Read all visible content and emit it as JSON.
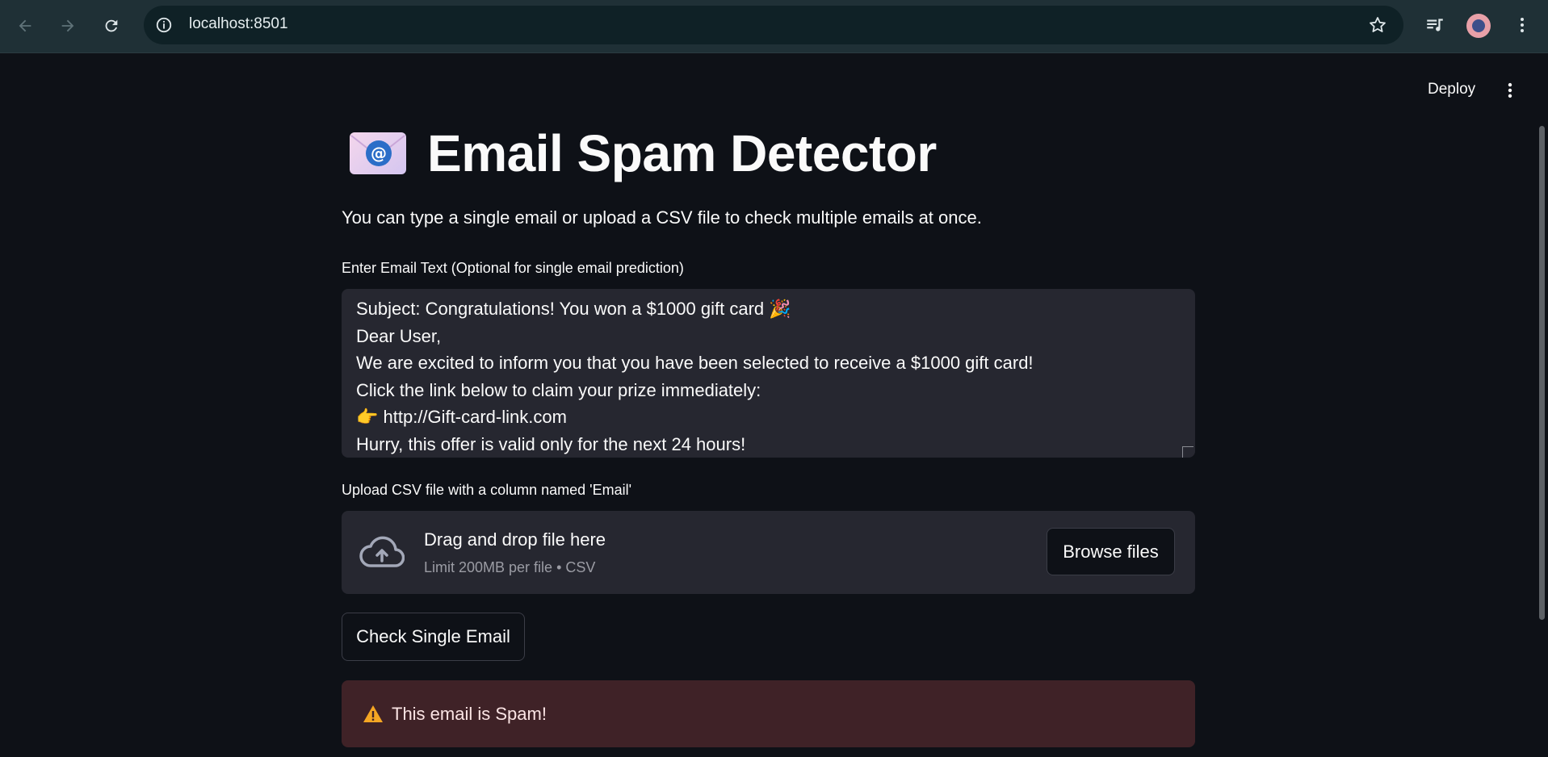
{
  "browser": {
    "url": "localhost:8501"
  },
  "app_header": {
    "deploy_label": "Deploy"
  },
  "page": {
    "title_icon": "envelope-with-at-icon",
    "title": "Email Spam Detector",
    "subtitle": "You can type a single email or upload a CSV file to check multiple emails at once."
  },
  "email_input": {
    "label": "Enter Email Text (Optional for single email prediction)",
    "lines": [
      "Subject: Congratulations! You won a $1000 gift card 🎉",
      "Dear User,",
      "We are excited to inform you that you have been selected to receive a $1000 gift card!",
      "Click the link below to claim your prize immediately:",
      "👉 http://Gift-card-link.com",
      "Hurry, this offer is valid only for the next 24 hours!"
    ]
  },
  "uploader": {
    "label": "Upload CSV file with a column named 'Email'",
    "drag_text": "Drag and drop file here",
    "limit_text": "Limit 200MB per file • CSV",
    "browse_label": "Browse files"
  },
  "actions": {
    "check_label": "Check Single Email"
  },
  "result": {
    "icon": "warning-icon",
    "text": "This email is Spam!"
  },
  "colors": {
    "background": "#0e1117",
    "input_background": "#262730",
    "error_background": "#3f2227",
    "chrome_background": "#1f3036"
  }
}
